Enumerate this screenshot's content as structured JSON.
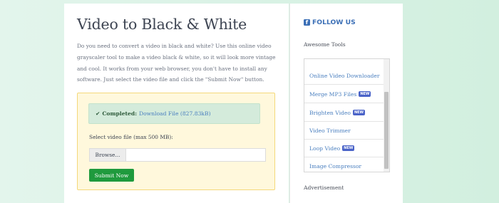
{
  "main": {
    "title": "Video to Black & White",
    "description": "Do you need to convert a video in black and white? Use this online video grayscaler tool to make a video black & white, so it will look more vintage and cool. It works from your web browser, you don't have to install any software. Just select the video file and click the \"Submit Now\" button.",
    "upload": {
      "success_check": "✔",
      "success_label": "Completed:",
      "download_link": "Download File (827.83kB)",
      "file_label": "Select video file (max 500 MB):",
      "browse_label": "Browse...",
      "submit_label": "Submit Now"
    }
  },
  "sidebar": {
    "follow_icon": "f",
    "follow_title": "FOLLOW US",
    "tools_heading": "Awesome Tools",
    "tools": [
      {
        "label": "Online Video Downloader",
        "badge": ""
      },
      {
        "label": "Merge MP3 Files",
        "badge": "NEW"
      },
      {
        "label": "Brighten Video",
        "badge": "NEW"
      },
      {
        "label": "Video Trimmer",
        "badge": ""
      },
      {
        "label": "Loop Video",
        "badge": "NEW"
      },
      {
        "label": "Image Compressor",
        "badge": ""
      }
    ],
    "ad_label": "Advertisement"
  },
  "colors": {
    "accent_green": "#1f9a3d",
    "link_blue": "#4a7fbf",
    "badge_blue": "#4a63c8",
    "panel_yellow": "#fff8dc"
  }
}
